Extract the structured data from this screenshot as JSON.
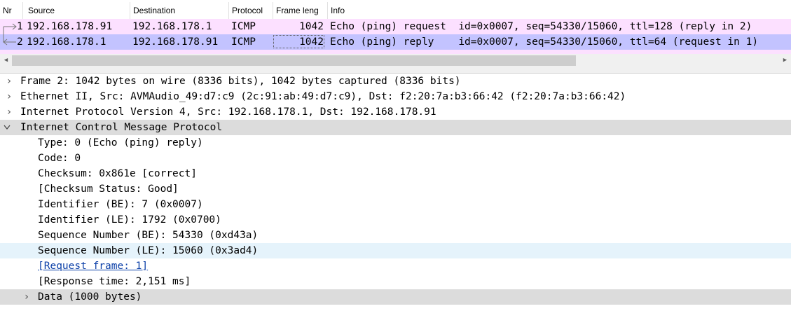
{
  "packet_list": {
    "columns": [
      "Nr",
      "Source",
      "Destination",
      "Protocol",
      "Frame leng",
      "Info"
    ],
    "rows": [
      {
        "no": "1",
        "source": "192.168.178.91",
        "destination": "192.168.178.1",
        "protocol": "ICMP",
        "length": "1042",
        "info": "Echo (ping) request  id=0x0007, seq=54330/15060, ttl=128 (reply in 2)",
        "color": "#fce0ff"
      },
      {
        "no": "2",
        "source": "192.168.178.1",
        "destination": "192.168.178.91",
        "protocol": "ICMP",
        "length": "1042",
        "info": "Echo (ping) reply    id=0x0007, seq=54330/15060, ttl=64 (request in 1)",
        "color": "#c3c3ff",
        "selected": true
      }
    ]
  },
  "details": {
    "frame": "Frame 2: 1042 bytes on wire (8336 bits), 1042 bytes captured (8336 bits)",
    "ethernet": "Ethernet II, Src: AVMAudio_49:d7:c9 (2c:91:ab:49:d7:c9), Dst: f2:20:7a:b3:66:42 (f2:20:7a:b3:66:42)",
    "ip": "Internet Protocol Version 4, Src: 192.168.178.1, Dst: 192.168.178.91",
    "icmp": "Internet Control Message Protocol",
    "icmp_fields": {
      "type": "Type: 0 (Echo (ping) reply)",
      "code": "Code: 0",
      "checksum": "Checksum: 0x861e [correct]",
      "checksum_status": "[Checksum Status: Good]",
      "id_be": "Identifier (BE): 7 (0x0007)",
      "id_le": "Identifier (LE): 1792 (0x0700)",
      "seq_be": "Sequence Number (BE): 54330 (0xd43a)",
      "seq_le": "Sequence Number (LE): 15060 (0x3ad4)",
      "request_frame": "[Request frame: 1]",
      "response_time": "[Response time: 2,151 ms]",
      "data": "Data (1000 bytes)"
    }
  },
  "colors": {
    "request_row": "#fce0ff",
    "reply_row": "#c3c3ff",
    "tree_highlight": "#dcdcdc",
    "field_highlight": "#e5f3fb",
    "link": "#0b3fa8"
  },
  "icons": {
    "related_request": "arrow-right-icon",
    "related_reply": "arrow-left-icon",
    "collapsed": "chevron-right-icon",
    "expanded": "chevron-down-icon"
  }
}
